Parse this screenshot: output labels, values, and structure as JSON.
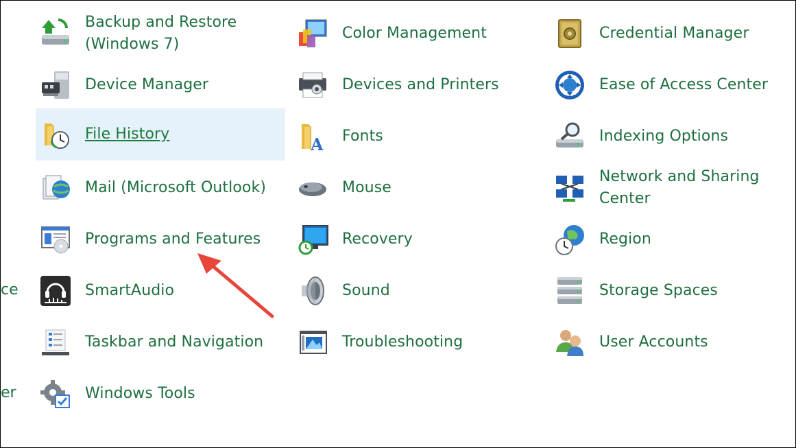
{
  "partial_left": [
    "ce",
    "er"
  ],
  "columns": {
    "col1": [
      {
        "label": "Backup and Restore (Windows 7)",
        "icon": "backup-restore-icon"
      },
      {
        "label": "Device Manager",
        "icon": "device-manager-icon"
      },
      {
        "label": "File History",
        "icon": "file-history-icon",
        "hover": true
      },
      {
        "label": "Mail (Microsoft Outlook)",
        "icon": "mail-icon"
      },
      {
        "label": "Programs and Features",
        "icon": "programs-features-icon"
      },
      {
        "label": "SmartAudio",
        "icon": "smartaudio-icon"
      },
      {
        "label": "Taskbar and Navigation",
        "icon": "taskbar-navigation-icon"
      },
      {
        "label": "Windows Tools",
        "icon": "windows-tools-icon"
      }
    ],
    "col2": [
      {
        "label": "Color Management",
        "icon": "color-management-icon"
      },
      {
        "label": "Devices and Printers",
        "icon": "devices-printers-icon"
      },
      {
        "label": "Fonts",
        "icon": "fonts-icon"
      },
      {
        "label": "Mouse",
        "icon": "mouse-icon"
      },
      {
        "label": "Recovery",
        "icon": "recovery-icon"
      },
      {
        "label": "Sound",
        "icon": "sound-icon"
      },
      {
        "label": "Troubleshooting",
        "icon": "troubleshooting-icon"
      }
    ],
    "col3": [
      {
        "label": "Credential Manager",
        "icon": "credential-manager-icon"
      },
      {
        "label": "Ease of Access Center",
        "icon": "ease-of-access-icon"
      },
      {
        "label": "Indexing Options",
        "icon": "indexing-options-icon"
      },
      {
        "label": "Network and Sharing Center",
        "icon": "network-sharing-icon"
      },
      {
        "label": "Region",
        "icon": "region-icon"
      },
      {
        "label": "Storage Spaces",
        "icon": "storage-spaces-icon"
      },
      {
        "label": "User Accounts",
        "icon": "user-accounts-icon"
      }
    ]
  },
  "colors": {
    "label": "#1e6f3f",
    "hover_bg": "#e5f1fb",
    "annotation_arrow": "#e8463a"
  }
}
